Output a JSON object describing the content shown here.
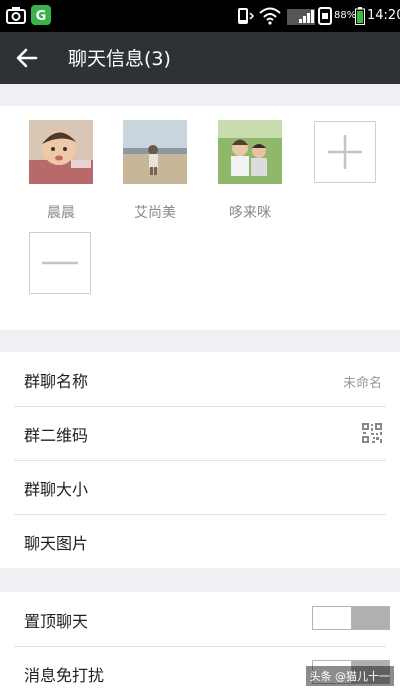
{
  "status_bar": {
    "battery": "88%",
    "time": "14:20",
    "icons": [
      "screenshot-icon",
      "app-notification-icon",
      "vibrate-icon",
      "wifi-icon",
      "signal-icon",
      "sim-icon",
      "battery-icon"
    ]
  },
  "header": {
    "title": "聊天信息(3)",
    "back_icon": "back-arrow-icon"
  },
  "members": [
    {
      "name": "晨晨",
      "avatar": "baby-photo"
    },
    {
      "name": "艾尚美",
      "avatar": "beach-photo"
    },
    {
      "name": "哆来咪",
      "avatar": "couple-photo"
    }
  ],
  "member_actions": {
    "add_icon": "plus-icon",
    "remove_icon": "minus-icon"
  },
  "group_settings": [
    {
      "label": "群聊名称",
      "value": "未命名"
    },
    {
      "label": "群二维码",
      "icon": "qr-code-icon"
    },
    {
      "label": "群聊大小"
    },
    {
      "label": "聊天图片"
    }
  ],
  "toggles": [
    {
      "label": "置顶聊天",
      "on": false
    },
    {
      "label": "消息免打扰",
      "on": false
    }
  ],
  "watermark": "头条 @猫儿十一",
  "colors": {
    "app_bar": "#2f3235",
    "background": "#efeff4",
    "toggle_track": "#b0b0b0"
  }
}
